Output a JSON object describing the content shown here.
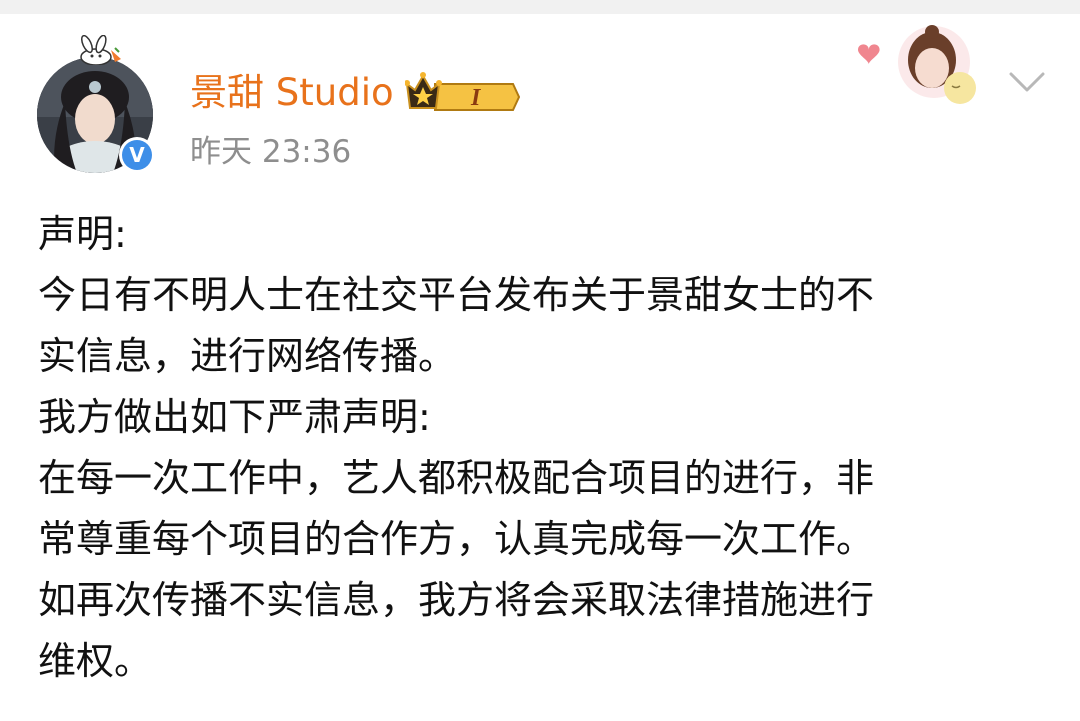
{
  "post": {
    "author": {
      "name": "景甜 Studio",
      "verified_mark": "V",
      "member_badge_level": "I",
      "icons": [
        "bunny-icon",
        "crown-icon",
        "verified-icon",
        "chevron-down-icon"
      ]
    },
    "timestamp": "昨天 23:36",
    "body_lines": [
      "声明:",
      "今日有不明人士在社交平台发布关于景甜女士的不",
      "实信息，进行网络传播。",
      "我方做出如下严肃声明:",
      "在每一次工作中，艺人都积极配合项目的进行，非",
      "常尊重每个项目的合作方，认真完成每一次工作。",
      "如再次传播不实信息，我方将会采取法律措施进行",
      "维权。"
    ]
  },
  "colors": {
    "username": "#e8721b",
    "timestamp": "#8e8e8e",
    "verified": "#3d8ee8",
    "badge_gold": "#f5b52e",
    "body_text": "#111111"
  }
}
